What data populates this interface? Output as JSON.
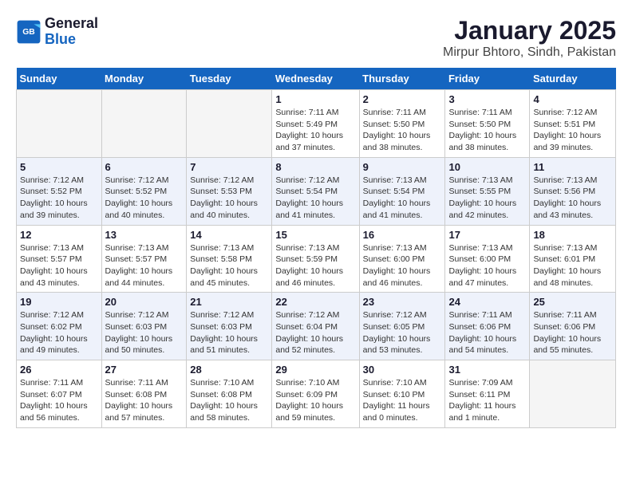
{
  "header": {
    "logo_line1": "General",
    "logo_line2": "Blue",
    "title": "January 2025",
    "subtitle": "Mirpur Bhtoro, Sindh, Pakistan"
  },
  "days_of_week": [
    "Sunday",
    "Monday",
    "Tuesday",
    "Wednesday",
    "Thursday",
    "Friday",
    "Saturday"
  ],
  "weeks": [
    [
      {
        "day": "",
        "info": ""
      },
      {
        "day": "",
        "info": ""
      },
      {
        "day": "",
        "info": ""
      },
      {
        "day": "1",
        "info": "Sunrise: 7:11 AM\nSunset: 5:49 PM\nDaylight: 10 hours\nand 37 minutes."
      },
      {
        "day": "2",
        "info": "Sunrise: 7:11 AM\nSunset: 5:50 PM\nDaylight: 10 hours\nand 38 minutes."
      },
      {
        "day": "3",
        "info": "Sunrise: 7:11 AM\nSunset: 5:50 PM\nDaylight: 10 hours\nand 38 minutes."
      },
      {
        "day": "4",
        "info": "Sunrise: 7:12 AM\nSunset: 5:51 PM\nDaylight: 10 hours\nand 39 minutes."
      }
    ],
    [
      {
        "day": "5",
        "info": "Sunrise: 7:12 AM\nSunset: 5:52 PM\nDaylight: 10 hours\nand 39 minutes."
      },
      {
        "day": "6",
        "info": "Sunrise: 7:12 AM\nSunset: 5:52 PM\nDaylight: 10 hours\nand 40 minutes."
      },
      {
        "day": "7",
        "info": "Sunrise: 7:12 AM\nSunset: 5:53 PM\nDaylight: 10 hours\nand 40 minutes."
      },
      {
        "day": "8",
        "info": "Sunrise: 7:12 AM\nSunset: 5:54 PM\nDaylight: 10 hours\nand 41 minutes."
      },
      {
        "day": "9",
        "info": "Sunrise: 7:13 AM\nSunset: 5:54 PM\nDaylight: 10 hours\nand 41 minutes."
      },
      {
        "day": "10",
        "info": "Sunrise: 7:13 AM\nSunset: 5:55 PM\nDaylight: 10 hours\nand 42 minutes."
      },
      {
        "day": "11",
        "info": "Sunrise: 7:13 AM\nSunset: 5:56 PM\nDaylight: 10 hours\nand 43 minutes."
      }
    ],
    [
      {
        "day": "12",
        "info": "Sunrise: 7:13 AM\nSunset: 5:57 PM\nDaylight: 10 hours\nand 43 minutes."
      },
      {
        "day": "13",
        "info": "Sunrise: 7:13 AM\nSunset: 5:57 PM\nDaylight: 10 hours\nand 44 minutes."
      },
      {
        "day": "14",
        "info": "Sunrise: 7:13 AM\nSunset: 5:58 PM\nDaylight: 10 hours\nand 45 minutes."
      },
      {
        "day": "15",
        "info": "Sunrise: 7:13 AM\nSunset: 5:59 PM\nDaylight: 10 hours\nand 46 minutes."
      },
      {
        "day": "16",
        "info": "Sunrise: 7:13 AM\nSunset: 6:00 PM\nDaylight: 10 hours\nand 46 minutes."
      },
      {
        "day": "17",
        "info": "Sunrise: 7:13 AM\nSunset: 6:00 PM\nDaylight: 10 hours\nand 47 minutes."
      },
      {
        "day": "18",
        "info": "Sunrise: 7:13 AM\nSunset: 6:01 PM\nDaylight: 10 hours\nand 48 minutes."
      }
    ],
    [
      {
        "day": "19",
        "info": "Sunrise: 7:12 AM\nSunset: 6:02 PM\nDaylight: 10 hours\nand 49 minutes."
      },
      {
        "day": "20",
        "info": "Sunrise: 7:12 AM\nSunset: 6:03 PM\nDaylight: 10 hours\nand 50 minutes."
      },
      {
        "day": "21",
        "info": "Sunrise: 7:12 AM\nSunset: 6:03 PM\nDaylight: 10 hours\nand 51 minutes."
      },
      {
        "day": "22",
        "info": "Sunrise: 7:12 AM\nSunset: 6:04 PM\nDaylight: 10 hours\nand 52 minutes."
      },
      {
        "day": "23",
        "info": "Sunrise: 7:12 AM\nSunset: 6:05 PM\nDaylight: 10 hours\nand 53 minutes."
      },
      {
        "day": "24",
        "info": "Sunrise: 7:11 AM\nSunset: 6:06 PM\nDaylight: 10 hours\nand 54 minutes."
      },
      {
        "day": "25",
        "info": "Sunrise: 7:11 AM\nSunset: 6:06 PM\nDaylight: 10 hours\nand 55 minutes."
      }
    ],
    [
      {
        "day": "26",
        "info": "Sunrise: 7:11 AM\nSunset: 6:07 PM\nDaylight: 10 hours\nand 56 minutes."
      },
      {
        "day": "27",
        "info": "Sunrise: 7:11 AM\nSunset: 6:08 PM\nDaylight: 10 hours\nand 57 minutes."
      },
      {
        "day": "28",
        "info": "Sunrise: 7:10 AM\nSunset: 6:08 PM\nDaylight: 10 hours\nand 58 minutes."
      },
      {
        "day": "29",
        "info": "Sunrise: 7:10 AM\nSunset: 6:09 PM\nDaylight: 10 hours\nand 59 minutes."
      },
      {
        "day": "30",
        "info": "Sunrise: 7:10 AM\nSunset: 6:10 PM\nDaylight: 11 hours\nand 0 minutes."
      },
      {
        "day": "31",
        "info": "Sunrise: 7:09 AM\nSunset: 6:11 PM\nDaylight: 11 hours\nand 1 minute."
      },
      {
        "day": "",
        "info": ""
      }
    ]
  ]
}
